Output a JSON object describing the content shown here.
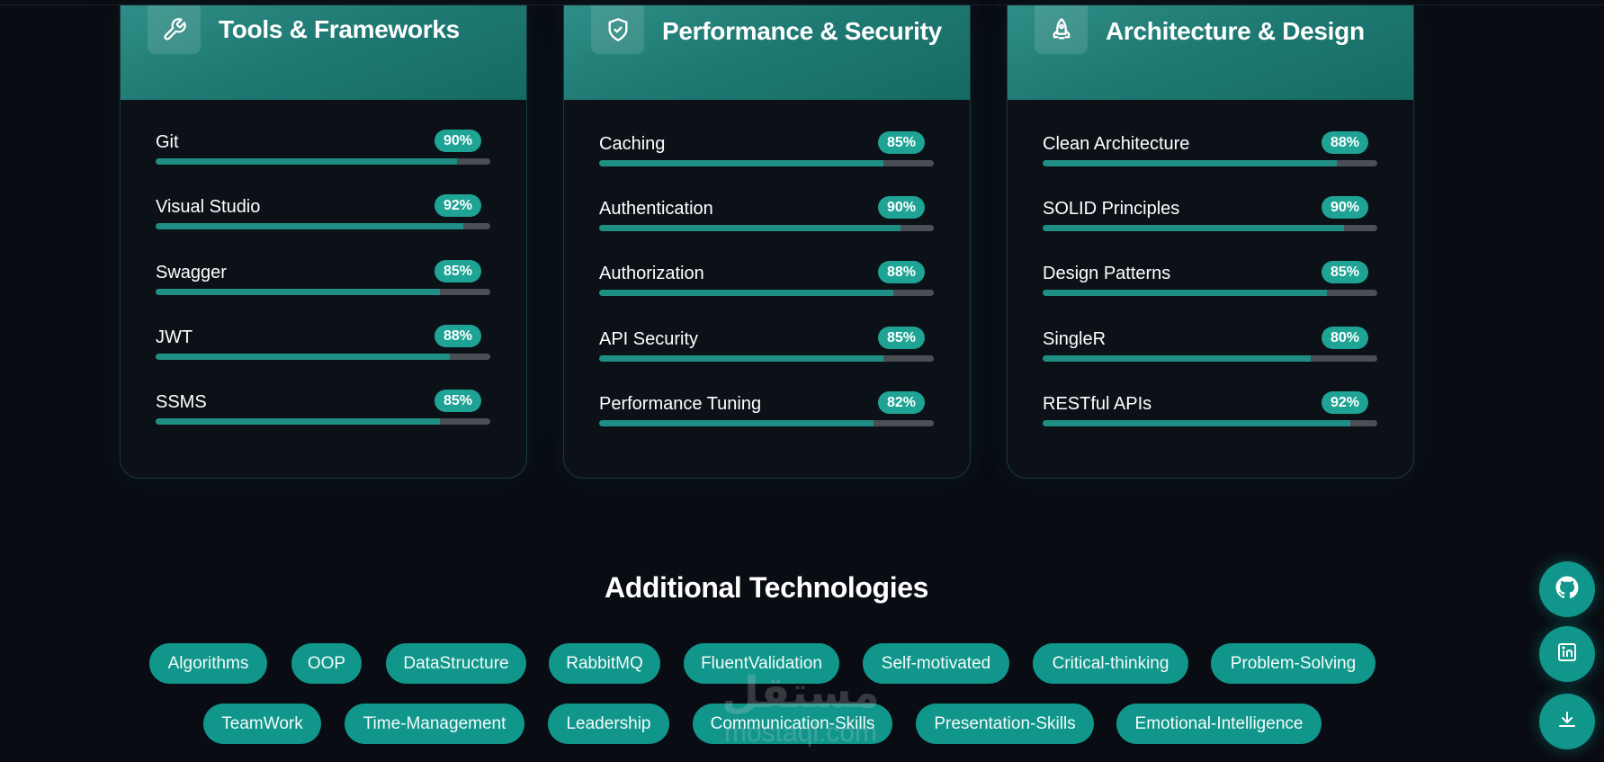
{
  "cards": [
    {
      "title": "Tools & Frameworks",
      "icon": "wrench-icon",
      "skills": [
        {
          "name": "Git",
          "percent": "90%",
          "level": 90
        },
        {
          "name": "Visual Studio",
          "percent": "92%",
          "level": 92
        },
        {
          "name": "Swagger",
          "percent": "85%",
          "level": 85
        },
        {
          "name": "JWT",
          "percent": "88%",
          "level": 88
        },
        {
          "name": "SSMS",
          "percent": "85%",
          "level": 85
        }
      ]
    },
    {
      "title": "Performance & Security",
      "icon": "shield-check-icon",
      "skills": [
        {
          "name": "Caching",
          "percent": "85%",
          "level": 85
        },
        {
          "name": "Authentication",
          "percent": "90%",
          "level": 90
        },
        {
          "name": "Authorization",
          "percent": "88%",
          "level": 88
        },
        {
          "name": "API Security",
          "percent": "85%",
          "level": 85
        },
        {
          "name": "Performance Tuning",
          "percent": "82%",
          "level": 82
        }
      ]
    },
    {
      "title": "Architecture & Design",
      "icon": "rocket-icon",
      "skills": [
        {
          "name": "Clean Architecture",
          "percent": "88%",
          "level": 88
        },
        {
          "name": "SOLID Principles",
          "percent": "90%",
          "level": 90
        },
        {
          "name": "Design Patterns",
          "percent": "85%",
          "level": 85
        },
        {
          "name": "SingleR",
          "percent": "80%",
          "level": 80
        },
        {
          "name": "RESTful APIs",
          "percent": "92%",
          "level": 92
        }
      ]
    }
  ],
  "additional": {
    "title": "Additional Technologies",
    "tags_row1": [
      "Algorithms",
      "OOP",
      "DataStructure",
      "RabbitMQ",
      "FluentValidation",
      "Self-motivated",
      "Critical-thinking",
      "Problem-Solving"
    ],
    "tags_row2": [
      "TeamWork",
      "Time-Management",
      "Leadership",
      "Communication-Skills",
      "Presentation-Skills",
      "Emotional-Intelligence"
    ]
  },
  "fabs": [
    "github-icon",
    "linkedin-icon",
    "download-icon"
  ],
  "watermark": {
    "logo": "مستقل",
    "text": "mostaql.com"
  },
  "colors": {
    "accent": "#11968b",
    "bar_fill": "#1f8f85",
    "bar_track": "#4a4f55",
    "background": "#090c12"
  }
}
